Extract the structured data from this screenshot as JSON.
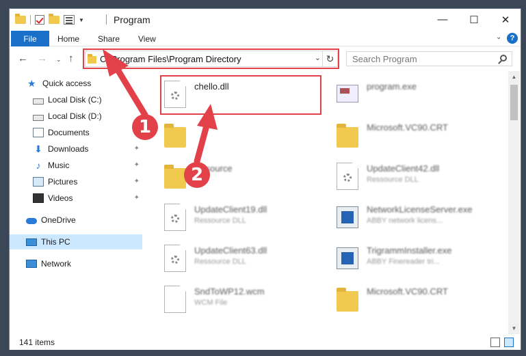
{
  "window": {
    "title": "Program"
  },
  "ribbon": {
    "file": "File",
    "home": "Home",
    "share": "Share",
    "view": "View",
    "help": "?"
  },
  "address": {
    "path": "C:\\Program Files\\Program Directory"
  },
  "search": {
    "placeholder": "Search Program"
  },
  "sidebar": {
    "items": [
      {
        "label": "Quick access",
        "icon": "star-icon"
      },
      {
        "label": "Local Disk (C:)",
        "icon": "drive-icon"
      },
      {
        "label": "Local Disk (D:)",
        "icon": "drive-icon"
      },
      {
        "label": "Documents",
        "icon": "documents-icon"
      },
      {
        "label": "Downloads",
        "icon": "download-icon"
      },
      {
        "label": "Music",
        "icon": "music-icon"
      },
      {
        "label": "Pictures",
        "icon": "pictures-icon"
      },
      {
        "label": "Videos",
        "icon": "videos-icon"
      },
      {
        "label": "OneDrive",
        "icon": "cloud-icon"
      },
      {
        "label": "This PC",
        "icon": "computer-icon"
      },
      {
        "label": "Network",
        "icon": "network-icon"
      }
    ]
  },
  "files": [
    {
      "name": "chello.dll",
      "desc": ""
    },
    {
      "name": "program.exe",
      "desc": ""
    },
    {
      "name": "",
      "desc": ""
    },
    {
      "name": "Microsoft.VC90.CRT",
      "desc": ""
    },
    {
      "name": "Resource",
      "desc": ""
    },
    {
      "name": "UpdateClient42.dll",
      "desc": "Ressource DLL"
    },
    {
      "name": "UpdateClient19.dll",
      "desc": "Ressource DLL"
    },
    {
      "name": "NetworkLicenseServer.exe",
      "desc": "ABBY network licens..."
    },
    {
      "name": "UpdateClient63.dll",
      "desc": "Ressource DLL"
    },
    {
      "name": "TrigrammInstaller.exe",
      "desc": "ABBY Finereader tri..."
    },
    {
      "name": "SndToWP12.wcm",
      "desc": "WCM File"
    },
    {
      "name": "Microsoft.VC90.CRT",
      "desc": ""
    }
  ],
  "status": {
    "count": "141 items"
  },
  "annotations": {
    "step1": "1",
    "step2": "2"
  },
  "colors": {
    "accent": "#1a6fc9",
    "highlight": "#e3414a",
    "selected": "#cce8ff"
  }
}
